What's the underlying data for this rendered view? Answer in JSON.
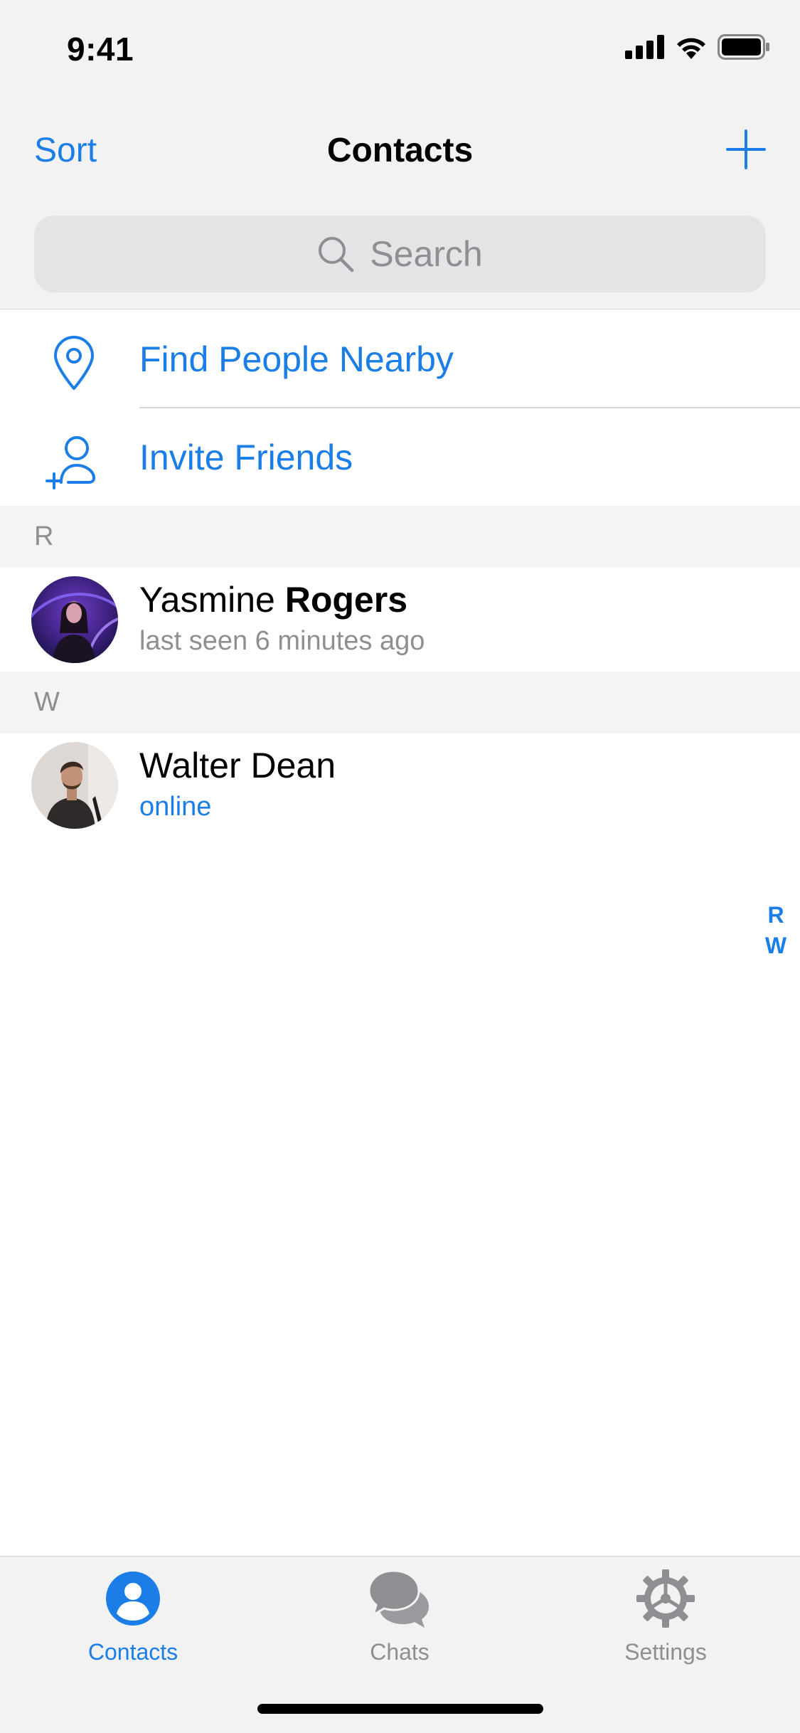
{
  "status_bar": {
    "time": "9:41"
  },
  "nav": {
    "sort_label": "Sort",
    "title": "Contacts"
  },
  "search": {
    "placeholder": "Search"
  },
  "actions": [
    {
      "label": "Find People Nearby",
      "icon": "location-pin-icon"
    },
    {
      "label": "Invite Friends",
      "icon": "add-person-icon"
    }
  ],
  "sections": [
    {
      "letter": "R",
      "contacts": [
        {
          "first_name": "Yasmine",
          "last_name": "Rogers",
          "status": "last seen 6 minutes ago",
          "online": false
        }
      ]
    },
    {
      "letter": "W",
      "contacts": [
        {
          "first_name": "Walter",
          "last_name": "Dean",
          "status": "online",
          "online": true
        }
      ]
    }
  ],
  "index": [
    "R",
    "W"
  ],
  "tabs": [
    {
      "label": "Contacts",
      "icon": "person-circle-icon",
      "active": true
    },
    {
      "label": "Chats",
      "icon": "chat-bubbles-icon",
      "active": false
    },
    {
      "label": "Settings",
      "icon": "gear-icon",
      "active": false
    }
  ],
  "colors": {
    "accent": "#1a7ee6",
    "secondary_text": "#8e8e93",
    "background_gray": "#f2f2f3"
  }
}
